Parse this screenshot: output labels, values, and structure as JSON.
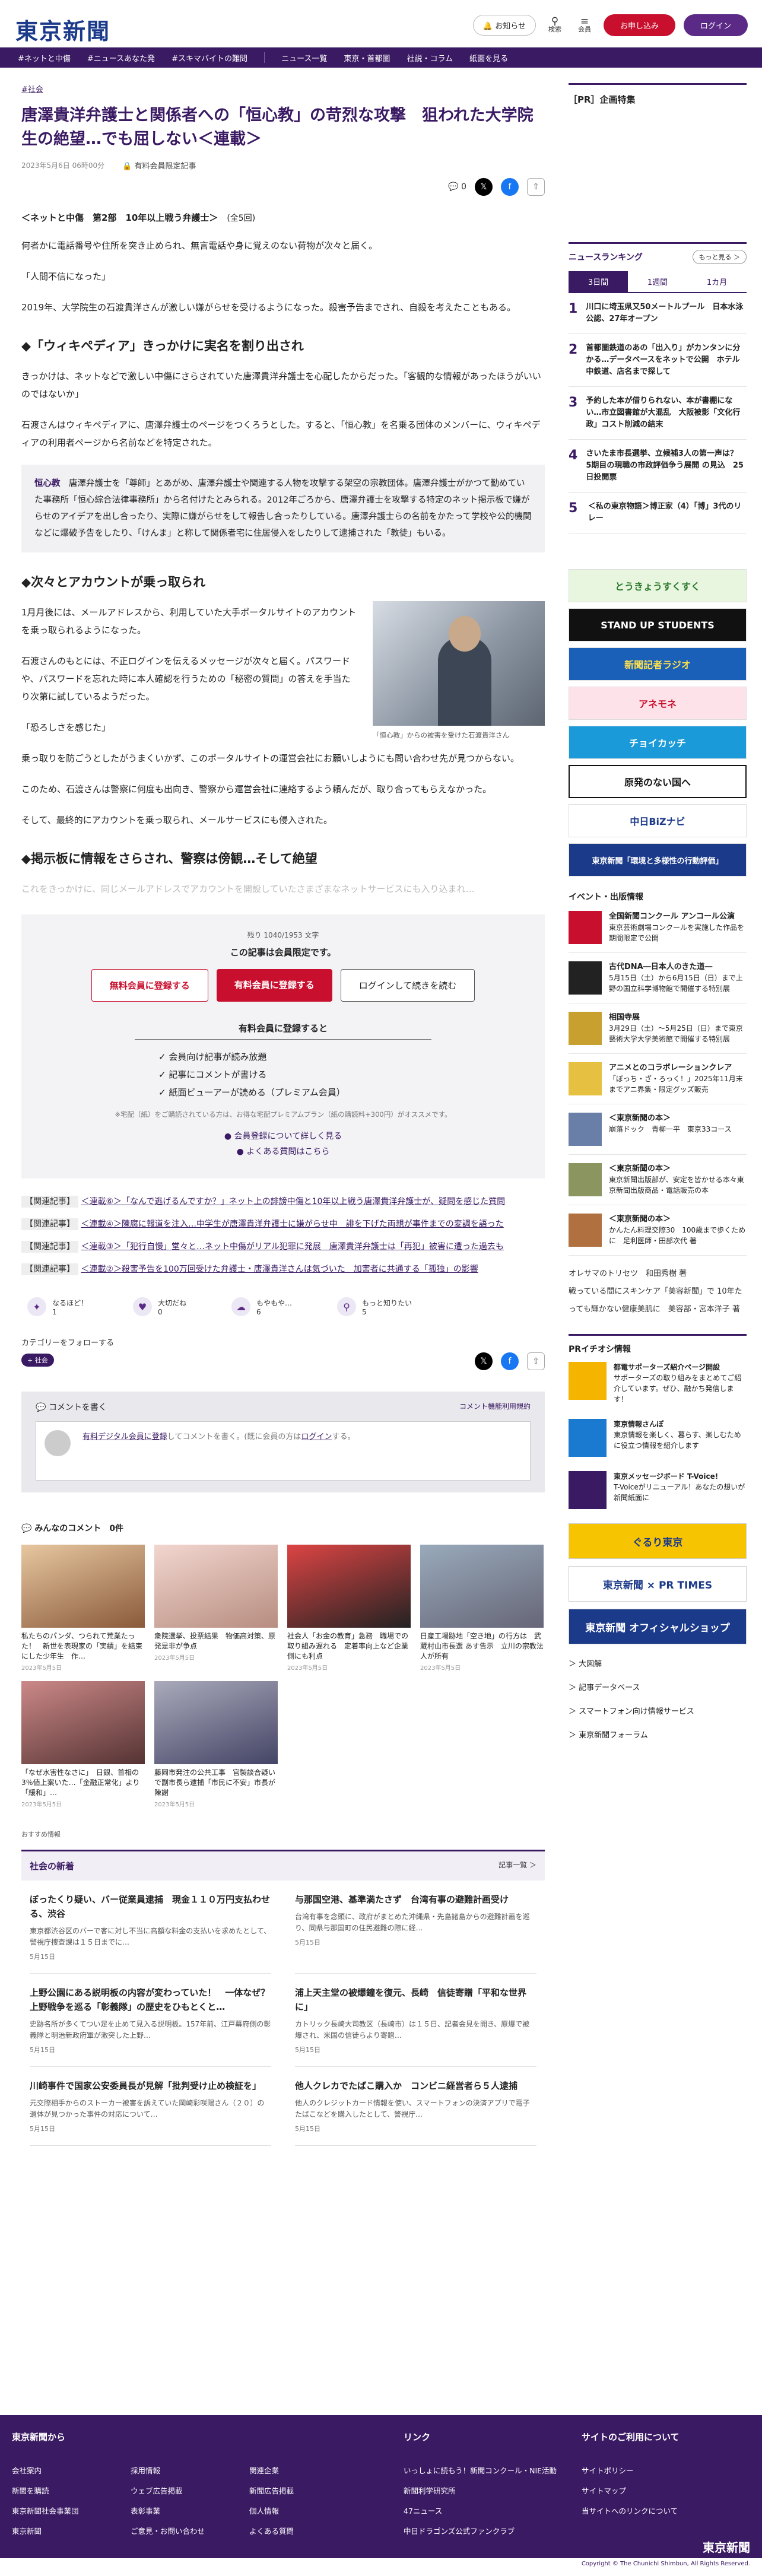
{
  "header": {
    "logo": "東京新聞",
    "notify": "お知らせ",
    "search": "検索",
    "menu": "会員",
    "login": "ログイン",
    "register": "お申し込み"
  },
  "nav": [
    "#ネットと中傷",
    "#ニュースあなた発",
    "#スキマバイトの難問",
    "ニュース一覧",
    "東京・首都圏",
    "社説・コラム",
    "紙面を見る"
  ],
  "article": {
    "tag": "#社会",
    "title": "唐澤貴洋弁護士と関係者への「恒心教」の苛烈な攻撃　狙われた大学院生の絶望…でも屈しない＜連載＞",
    "date": "2023年5月6日 06時00分",
    "member_label": "有料会員限定記事",
    "comment_count": "0",
    "series": "＜ネットと中傷　第2部　10年以上戦う弁護士＞",
    "series_count": "(全5回)",
    "p1": "何者かに電話番号や住所を突き止められ、無言電話や身に覚えのない荷物が次々と届く。",
    "p2": "「人間不信になった」",
    "p3": "2019年、大学院生の石渡貴洋さんが激しい嫌がらせを受けるようになった。殺害予告までされ、自殺を考えたこともある。",
    "h1": "◆「ウィキペディア」きっかけに実名を割り出され",
    "p4": "きっかけは、ネットなどで激しい中傷にさらされていた唐澤貴洋弁護士を心配したからだった。「客観的な情報があったほうがいいのではないか」",
    "p5": "石渡さんはウィキペディアに、唐澤弁護士のページをつくろうとした。すると、「恒心教」を名乗る団体のメンバーに、ウィキペディアの利用者ページから名前などを特定された。",
    "note_term": "恒心教",
    "note_text": "唐澤弁護士を「尊師」とあがめ、唐澤弁護士や関連する人物を攻撃する架空の宗教団体。唐澤弁護士がかつて勤めていた事務所「恒心綜合法律事務所」から名付けたとみられる。2012年ごろから、唐澤弁護士を攻撃する特定のネット掲示板で嫌がらせのアイデアを出し合ったり、実際に嫌がらせをして報告し合ったりしている。唐澤弁護士らの名前をかたって学校や公的機関などに爆破予告をしたり、「けんま」と称して関係者宅に住居侵入をしたりして逮捕された「教徒」もいる。",
    "h2": "◆次々とアカウントが乗っ取られ",
    "photo_caption": "「恒心教」からの被害を受けた石渡貴洋さん",
    "p6": "1月月後には、メールアドレスから、利用していた大手ポータルサイトのアカウントを乗っ取られるようになった。",
    "p7": "石渡さんのもとには、不正ログインを伝えるメッセージが次々と届く。パスワードや、パスワードを忘れた時に本人確認を行うための「秘密の質問」の答えを手当たり次第に試しているようだった。",
    "p8": "「恐ろしさを感じた」",
    "p9": "乗っ取りを防ごうとしたがうまくいかず、このポータルサイトの運営会社にお願いしようにも問い合わせ先が見つからない。",
    "p10": "このため、石渡さんは警察に何度も出向き、警察から運営会社に連絡するよう頼んだが、取り合ってもらえなかった。",
    "p11": "そして、最終的にアカウントを乗っ取られ、メールサービスにも侵入された。",
    "h3": "◆掲示板に情報をさらされ、警察は傍観…そして絶望",
    "fade": "これをきっかけに、同じメールアドレスでアカウントを開設していたさまざまなネットサービスにも入り込まれ…"
  },
  "paywall": {
    "remain": "残り 1040/1953 文字",
    "lead": "この記事は会員限定です。",
    "b1": "無料会員に登録する",
    "b2": "有料会員に登録する",
    "b3": "ログインして続きを読む",
    "merit": "有料会員に登録すると",
    "l1": "✓ 会員向け記事が読み放題",
    "l2": "✓ 記事にコメントが書ける",
    "l3": "✓ 紙面ビューアーが読める（プレミアム会員）",
    "foot": "※宅配（紙）をご購読されている方は、お得な宅配プレミアムプラン（紙の購読料+300円）がオススメです。",
    "q1": "● 会員登録について詳しく見る",
    "q2": "● よくある質問はこちら"
  },
  "related": [
    {
      "label": "【関連記事】",
      "text": "＜連載⑥＞「なんで逃げるんですか？」ネット上の誹謗中傷と10年以上戦う唐澤貴洋弁護士が、疑問を感じた質問"
    },
    {
      "label": "【関連記事】",
      "text": "＜連載④＞陳腐に報道を注入…中学生が唐澤貴洋弁護士に嫌がらせ中　誹を下げた両親が事件までの変調を語った"
    },
    {
      "label": "【関連記事】",
      "text": "＜連載③＞「犯行自慢」堂々と…ネット中傷がリアル犯罪に発展　唐澤貴洋弁護士は「再犯」被害に遭った過去も"
    },
    {
      "label": "【関連記事】",
      "text": "＜連載②＞殺害予告を100万回受けた弁護士・唐澤貴洋さんは気づいた　加害者に共通する「孤独」の影響"
    }
  ],
  "reactions": [
    {
      "label": "なるほど！",
      "n": "1"
    },
    {
      "label": "大切だね",
      "n": "0"
    },
    {
      "label": "もやもや…",
      "n": "6"
    },
    {
      "label": "もっと知りたい",
      "n": "5"
    }
  ],
  "follow": {
    "label": "カテゴリーをフォローする",
    "chip": "社会"
  },
  "comment": {
    "head": "コメントを書く",
    "rule": "コメント機能利用規約",
    "link": "有料デジタル会員に登録",
    "rest": "してコメントを書く。(既に会員の方は",
    "login": "ログイン",
    "end": "する。"
  },
  "allc": {
    "label": "みんなのコメント",
    "n": "0件"
  },
  "thumbs": [
    {
      "t": "私たちのパンダ、つられて荒業たった！　新世を表現家の「実績」を結束にした少年生　作…",
      "d": "2023年5月5日"
    },
    {
      "t": "衆院選挙、投票結果　物価高対策、原発是非が争点",
      "d": "2023年5月5日"
    },
    {
      "t": "社会人「お金の教育」急務　職場での取り組み遅れる　定着率向上など企業側にも利点",
      "d": "2023年5月5日"
    },
    {
      "t": "日産工場跡地「空き地」の行方は　武蔵村山市長選 あす告示　立川の宗教法人が所有",
      "d": "2023年5月5日"
    },
    {
      "t": "「なぜ水害性なさに」　日銀、首相の3％値上案いた…「金融正常化」より「緩和」…",
      "d": "2023年5月5日"
    },
    {
      "t": "藤岡市発注の公共工事　官製談合疑いで副市長ら逮捕「市民に不安」市長が陳謝",
      "d": "2023年5月5日"
    }
  ],
  "reco": "おすすめ情報",
  "news": {
    "head": "社会の新着",
    "more": "記事一覧 ＞",
    "items": [
      {
        "t": "ぼったくり疑い、バー従業員逮捕　現金１１０万円支払わせる、渋谷",
        "d": "東京都渋谷区のバーで客に対し不当に高額な料金の支払いを求めたとして、警視庁捜査課は１５日までに…",
        "dt": "5月15日"
      },
      {
        "t": "与那国空港、基準満たさず　台湾有事の避難計画受け",
        "d": "台湾有事を念頭に、政府がまとめた沖縄県・先島諸島からの避難計画を巡り、同県与那国町の住民避難の際に経…",
        "dt": "5月15日"
      },
      {
        "t": "上野公園にある説明板の内容が変わっていた！　一体なぜ？　上野戦争を巡る「彰義隊」の歴史をひもとくと…",
        "d": "史跡名所が多くてつい足を止めて見入る説明板。157年前、江戸幕府側の彰義隊と明治新政府軍が激突した上野…",
        "dt": "5月15日"
      },
      {
        "t": "浦上天主堂の被爆鐘を復元、長崎　信徒寄贈「平和な世界に」",
        "d": "カトリック長崎大司教区（長崎市）は１５日、記者会見を開き、原爆で被爆され、米国の信徒らより寄贈…",
        "dt": "5月15日"
      },
      {
        "t": "川崎事件で国家公安委員長が見解「批判受け止め検証を」",
        "d": "元交際相手からのストーカー被害を訴えていた岡崎彩咲陽さん（２０）の遺体が見つかった事件の対応について…",
        "dt": "5月15日"
      },
      {
        "t": "他人クレカでたばこ購入か　コンビニ経営者ら５人逮捕",
        "d": "他人のクレジットカード情報を使い、スマートフォンの決済アプリで電子たばこなどを購入したとして、警視庁…",
        "dt": "5月15日"
      }
    ]
  },
  "sidebar": {
    "pr": "［PR］企画特集",
    "rank_head": "ニュースランキング",
    "rank_more": "もっと見る ＞",
    "tabs": [
      "3日間",
      "1週間",
      "1カ月"
    ],
    "ranks": [
      {
        "n": "1",
        "t": "川口に埼玉県又50メートルプール　日本水泳公認、27年オープン"
      },
      {
        "n": "2",
        "t": "首都圏鉄道のあの「出入り」がカンタンに分かる…データベースをネットで公開　ホテル中鉄道、店名まで探して"
      },
      {
        "n": "3",
        "t": "予約した本が借りられない、本が書棚にない…市立図書館が大混乱　大阪被影「文化行政」コスト削減の結末"
      },
      {
        "n": "4",
        "t": "さいたま市長選挙、立候補3人の第一声は？　5期目の現職の市政評価争う展開 の見込　25日投開票"
      },
      {
        "n": "5",
        "t": "＜私の東京物語＞博正家（4）「博」3代のリレー"
      }
    ],
    "banners": [
      "とうきょうすくすく",
      "STAND UP STUDENTS",
      "新聞記者ラジオ",
      "アネモネ",
      "チョイカッチ",
      "原発のない国へ",
      "中日BiZナビ",
      "東京新聞「環境と多様性の行動評価」"
    ],
    "ev_head": "イベント・出版情報",
    "events": [
      {
        "t": "全国新聞コンクール アンコール公演",
        "d": "東京芸術劇場コンクールを実施した作品を期間限定で公開"
      },
      {
        "t": "古代DNA―日本人のきた道―",
        "d": "5月15日（土）から6月15日（日）まで上野の国立科学博物館で開催する特別展"
      },
      {
        "t": "相国寺展",
        "d": "3月29日（土）〜5月25日（日）まで東京藝術大学大学美術館で開催する特別展"
      },
      {
        "t": "アニメとのコラボレーションクレア",
        "d": "「ぼっち・ざ・ろっく！」2025年11月末までアニ界集・限定グッズ販売"
      },
      {
        "t": "＜東京新聞の本＞",
        "d": "崩落ドック　青柳一平　東京33コース"
      },
      {
        "t": "＜東京新聞の本＞",
        "d": "東京新聞出版部が、安定を皆かせる本々東京新聞出版商品・電話販売の本"
      },
      {
        "t": "＜東京新聞の本＞",
        "d": "かんたん料理交際30　100歳まで歩くために　足利医師・田部次代 著"
      }
    ],
    "plinks": [
      "オレサマのトリセツ　和田秀樹 著",
      "戦っている間にスキンケア「美容新聞」で 10年たっても輝かない健康美肌に　美容部・宮本洋子 著"
    ],
    "pr2": "PRイチオシ情報",
    "pris": [
      {
        "t": "都電サポーターズ紹介ページ開設",
        "d": "サポーターズの取り組みをまとめてご紹介しています。ぜひ、融かち発信します！"
      },
      {
        "t": "東京情報さんぽ",
        "d": "東京情報を楽しく、暮らす、楽しむために役立つ情報を紹介します"
      },
      {
        "t": "東京メッセージボード T-Voice!",
        "d": "T-Voiceがリニューアル！あなたの想いが新聞紙面に"
      }
    ],
    "sbtns": [
      "ぐるり東京",
      "東京新聞 × PR TIMES",
      "東京新聞 オフィシャルショップ"
    ],
    "slinks": [
      "＞ 大図解",
      "＞ 記事データベース",
      "＞ スマートフォン向け情報サービス",
      "＞ 東京新聞フォーラム"
    ]
  },
  "footer": {
    "c1h": "東京新聞から",
    "c2h": "リンク",
    "c3h": "サイトのご利用について",
    "c1": [
      "会社案内",
      "新聞を購読",
      "東京新聞社会事業団",
      "東京新聞",
      "採用情報",
      "ウェブ広告掲載",
      "表彰事業",
      "ご意見・お問い合わせ",
      "関連企業",
      "新聞広告掲載",
      "個人情報",
      "よくある質問"
    ],
    "c2": [
      "いっしょに読もう！新聞コンクール・NIE活動",
      "新聞利学研究所",
      "47ニュース",
      "中日ドラゴンズ公式ファンクラブ"
    ],
    "c3": [
      "サイトポリシー",
      "サイトマップ",
      "当サイトへのリンクについて"
    ],
    "copyright": "Copyright © The Chunichi Shimbun, All Rights Reserved.",
    "logo": "東京新聞"
  },
  "colors": {
    "brand": "#3a1a63",
    "accent": "#c8102e"
  }
}
